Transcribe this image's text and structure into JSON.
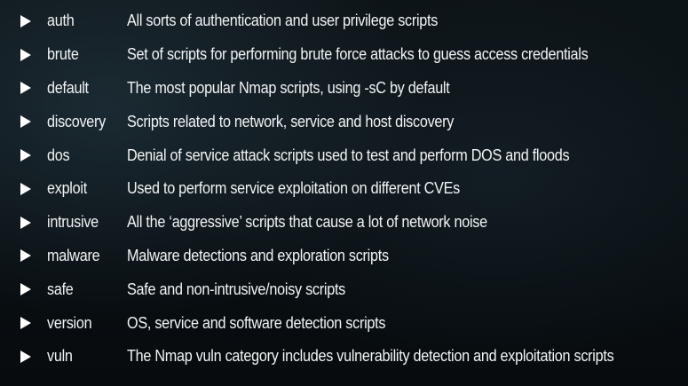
{
  "categories": [
    {
      "name": "auth",
      "description": "All sorts of authentication and user privilege scripts"
    },
    {
      "name": "brute",
      "description": "Set of scripts for performing brute force attacks to guess access credentials"
    },
    {
      "name": "default",
      "description": "The most popular Nmap scripts, using -sC by default"
    },
    {
      "name": "discovery",
      "description": "Scripts related to network, service and host discovery"
    },
    {
      "name": "dos",
      "description": "Denial of service attack scripts used to test and perform DOS and floods"
    },
    {
      "name": "exploit",
      "description": "Used to perform service exploitation on different CVEs"
    },
    {
      "name": "intrusive",
      "description": "All the ‘aggressive’ scripts that cause a lot of network noise"
    },
    {
      "name": "malware",
      "description": "Malware detections and exploration scripts"
    },
    {
      "name": "safe",
      "description": "Safe and non-intrusive/noisy scripts"
    },
    {
      "name": "version",
      "description": "OS, service and software detection scripts"
    },
    {
      "name": "vuln",
      "description": "The Nmap vuln category includes vulnerability detection and exploitation scripts"
    }
  ]
}
